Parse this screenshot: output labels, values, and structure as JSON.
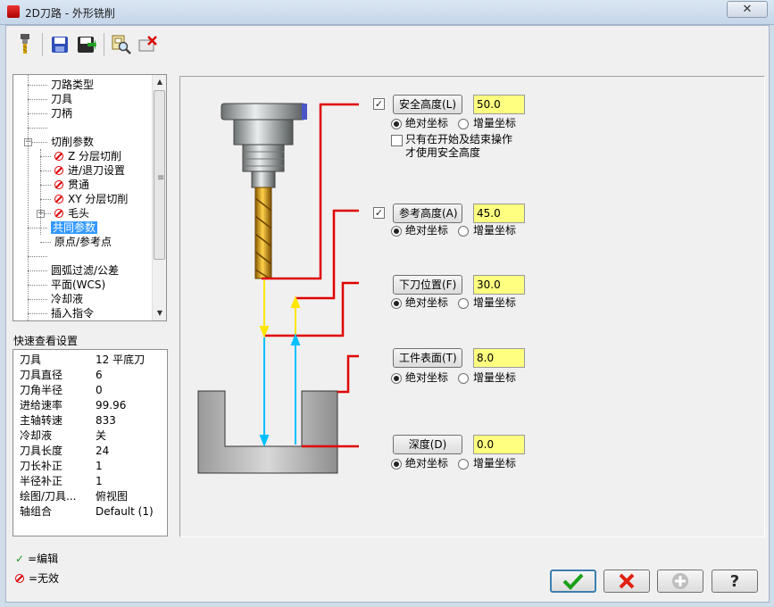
{
  "window": {
    "title": "2D刀路 - 外形铣削",
    "close_glyph": "✕"
  },
  "toolbar": {
    "icons": [
      "tool-icon",
      "save-icon",
      "save-as-icon",
      "view-icon",
      "delete-icon"
    ]
  },
  "tree": {
    "items": [
      {
        "label": "刀路类型",
        "depth": 0,
        "icon": ""
      },
      {
        "label": "刀具",
        "depth": 0,
        "icon": ""
      },
      {
        "label": "刀柄",
        "depth": 0,
        "icon": ""
      },
      {
        "label": "",
        "depth": 0,
        "icon": ""
      },
      {
        "label": "切削参数",
        "depth": 0,
        "icon": "",
        "expander": "−"
      },
      {
        "label": "Z 分层切削",
        "depth": 1,
        "icon": "disabled"
      },
      {
        "label": "进/退刀设置",
        "depth": 1,
        "icon": "disabled"
      },
      {
        "label": "贯通",
        "depth": 1,
        "icon": "disabled"
      },
      {
        "label": "XY 分层切削",
        "depth": 1,
        "icon": "disabled"
      },
      {
        "label": "毛头",
        "depth": 1,
        "icon": "disabled",
        "expander": "+"
      },
      {
        "label": "共同参数",
        "depth": 0,
        "icon": "",
        "selected": true
      },
      {
        "label": "原点/参考点",
        "depth": 1,
        "icon": ""
      },
      {
        "label": "",
        "depth": 0,
        "icon": ""
      },
      {
        "label": "圆弧过滤/公差",
        "depth": 0,
        "icon": ""
      },
      {
        "label": "平面(WCS)",
        "depth": 0,
        "icon": ""
      },
      {
        "label": "冷却液",
        "depth": 0,
        "icon": ""
      },
      {
        "label": "插入指令",
        "depth": 0,
        "icon": ""
      }
    ]
  },
  "quick_view": {
    "label": "快速查看设置",
    "rows": [
      {
        "key": "刀具",
        "value": "12 平底刀"
      },
      {
        "key": "刀具直径",
        "value": "6"
      },
      {
        "key": "刀角半径",
        "value": "0"
      },
      {
        "key": "进给速率",
        "value": "99.96"
      },
      {
        "key": "主轴转速",
        "value": "833"
      },
      {
        "key": "冷却液",
        "value": "关"
      },
      {
        "key": "刀具长度",
        "value": "24"
      },
      {
        "key": "刀长补正",
        "value": "1"
      },
      {
        "key": "半径补正",
        "value": "1"
      },
      {
        "key": "绘图/刀具...",
        "value": "俯视图"
      },
      {
        "key": "轴组合",
        "value": "Default (1)"
      }
    ]
  },
  "legend": {
    "edit": "=编辑",
    "invalid": "=无效",
    "edit_mark": "✓"
  },
  "params": {
    "safety": {
      "label": "安全高度(L)",
      "value": "50.0",
      "checked": true,
      "only_at_start_1": "只有在开始及结束操作",
      "only_at_start_2": "才使用安全高度"
    },
    "reference": {
      "label": "参考高度(A)",
      "value": "45.0",
      "checked": true
    },
    "feed_plane": {
      "label": "下刀位置(F)",
      "value": "30.0"
    },
    "top_of_stock": {
      "label": "工件表面(T)",
      "value": "8.0"
    },
    "depth": {
      "label": "深度(D)",
      "value": "0.0"
    },
    "absolute": "绝对坐标",
    "incremental": "增量坐标"
  },
  "colors": {
    "leader": "#e00000",
    "rapid": "#ffe600",
    "feed": "#00c0ff",
    "field": "#ffff80",
    "selected": "#3399ff"
  },
  "buttons": {
    "ok": "ok-icon",
    "cancel": "cancel-icon",
    "add": "add-icon",
    "help": "help-icon",
    "help_glyph": "?"
  }
}
